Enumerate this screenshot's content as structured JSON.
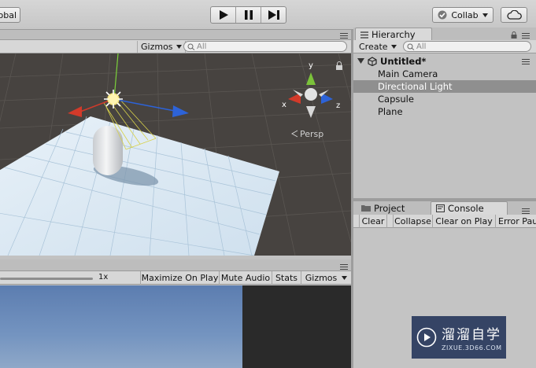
{
  "toolbar": {
    "global_label": "obal",
    "collab_label": "Collab",
    "play_icon": "play-icon",
    "pause_icon": "pause-icon",
    "step_icon": "step-icon"
  },
  "scene": {
    "gizmos_label": "Gizmos",
    "search_placeholder": "All",
    "persp_label": "Persp",
    "axis_x": "x",
    "axis_y": "y",
    "axis_z": "z"
  },
  "game": {
    "scale_label": "1x",
    "maximize_on_play": "Maximize On Play",
    "mute_audio": "Mute Audio",
    "stats": "Stats",
    "gizmos": "Gizmos"
  },
  "hierarchy": {
    "tab_label": "Hierarchy",
    "create_label": "Create",
    "search_placeholder": "All",
    "scene_name": "Untitled*",
    "items": [
      {
        "label": "Main Camera",
        "selected": false
      },
      {
        "label": "Directional Light",
        "selected": true
      },
      {
        "label": "Capsule",
        "selected": false
      },
      {
        "label": "Plane",
        "selected": false
      }
    ]
  },
  "bottom_panel": {
    "project_tab": "Project",
    "console_tab": "Console",
    "buttons": [
      "Clear",
      "Collapse",
      "Clear on Play",
      "Error Pau"
    ]
  },
  "watermark": {
    "title": "溜溜自学",
    "url": "ZIXUE.3D66.COM"
  },
  "colors": {
    "selection": "#8f8f8f",
    "axis_x": "#d23a2a",
    "axis_y": "#7bc23a",
    "axis_z": "#2d63d8"
  }
}
